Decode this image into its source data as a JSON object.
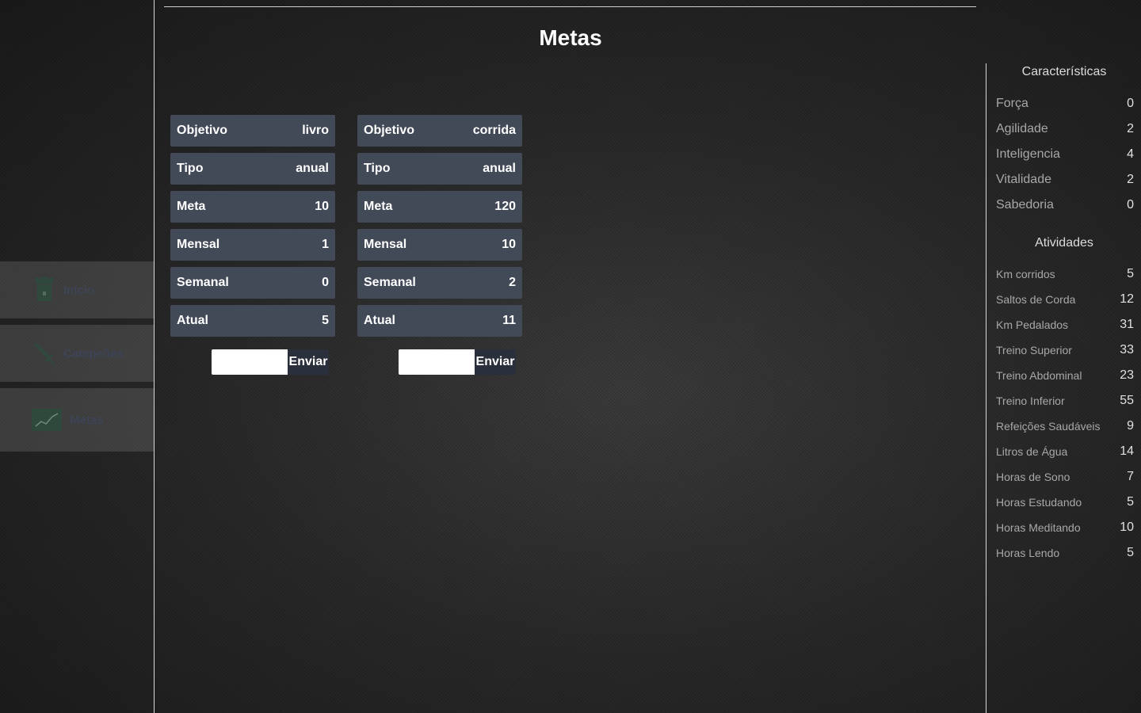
{
  "sidebar": {
    "items": [
      {
        "label": "Início",
        "icon": "tower-icon"
      },
      {
        "label": "Campeões",
        "icon": "sword-icon"
      },
      {
        "label": "Metas",
        "icon": "chart-icon"
      }
    ]
  },
  "page": {
    "title": "Metas"
  },
  "goals": [
    {
      "rows": [
        {
          "label": "Objetivo",
          "value": "livro"
        },
        {
          "label": "Tipo",
          "value": "anual"
        },
        {
          "label": "Meta",
          "value": "10"
        },
        {
          "label": "Mensal",
          "value": "1"
        },
        {
          "label": "Semanal",
          "value": "0"
        },
        {
          "label": "Atual",
          "value": "5"
        }
      ],
      "input_value": "",
      "submit_label": "Enviar"
    },
    {
      "rows": [
        {
          "label": "Objetivo",
          "value": "corrida"
        },
        {
          "label": "Tipo",
          "value": "anual"
        },
        {
          "label": "Meta",
          "value": "120"
        },
        {
          "label": "Mensal",
          "value": "10"
        },
        {
          "label": "Semanal",
          "value": "2"
        },
        {
          "label": "Atual",
          "value": "11"
        }
      ],
      "input_value": "",
      "submit_label": "Enviar"
    }
  ],
  "characteristics": {
    "title": "Características",
    "items": [
      {
        "label": "Força",
        "value": "0"
      },
      {
        "label": "Agilidade",
        "value": "2"
      },
      {
        "label": "Inteligencia",
        "value": "4"
      },
      {
        "label": "Vitalidade",
        "value": "2"
      },
      {
        "label": "Sabedoria",
        "value": "0"
      }
    ]
  },
  "activities": {
    "title": "Atividades",
    "items": [
      {
        "label": "Km corridos",
        "value": "5"
      },
      {
        "label": "Saltos de Corda",
        "value": "12"
      },
      {
        "label": "Km Pedalados",
        "value": "31"
      },
      {
        "label": "Treino Superior",
        "value": "33"
      },
      {
        "label": "Treino Abdominal",
        "value": "23"
      },
      {
        "label": "Treino Inferior",
        "value": "55"
      },
      {
        "label": "Refeições Saudáveis",
        "value": "9"
      },
      {
        "label": "Litros de Água",
        "value": "14"
      },
      {
        "label": "Horas de Sono",
        "value": "7"
      },
      {
        "label": "Horas Estudando",
        "value": "5"
      },
      {
        "label": "Horas Meditando",
        "value": "10"
      },
      {
        "label": "Horas Lendo",
        "value": "5"
      }
    ]
  },
  "colors": {
    "card_bg": "#434a57",
    "button_bg": "#2a303b",
    "sidebar_label": "#3d4456",
    "icon": "#2f4a3d"
  }
}
